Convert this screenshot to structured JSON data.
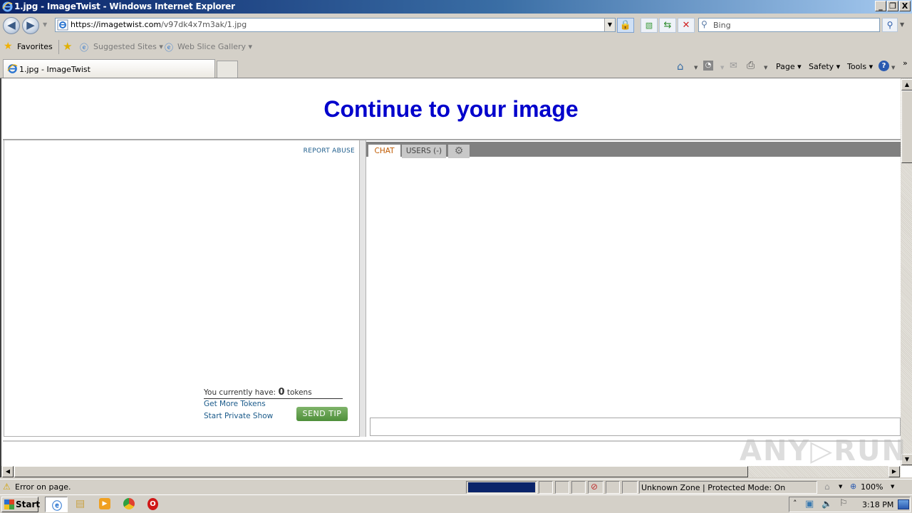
{
  "window": {
    "title": "1.jpg - ImageTwist - Windows Internet Explorer",
    "minimize": "_",
    "restore": "❐",
    "close": "X"
  },
  "address_bar": {
    "url_host": "https://imagetwist.com",
    "url_path": "/v97dk4x7m3ak/1.jpg",
    "search_placeholder": "Bing"
  },
  "favorites_bar": {
    "favorites_label": "Favorites",
    "items": [
      {
        "label": "Suggested Sites ▾"
      },
      {
        "label": "Web Slice Gallery ▾"
      }
    ]
  },
  "tabs": [
    {
      "label": "1.jpg - ImageTwist",
      "active": true
    }
  ],
  "command_bar": {
    "page": "Page ▾",
    "safety": "Safety ▾",
    "tools": "Tools ▾",
    "more": "»"
  },
  "page": {
    "heading": "Continue to your image",
    "left_panel": {
      "report_abuse": "REPORT ABUSE",
      "tokens_prefix": "You currently have:",
      "tokens_count": "0",
      "tokens_suffix": "tokens",
      "get_more_tokens": "Get More Tokens",
      "start_private_show": "Start Private Show",
      "send_tip": "SEND TIP"
    },
    "chat_panel": {
      "tabs": [
        {
          "label": "CHAT",
          "active": true
        },
        {
          "label": "USERS (-)",
          "active": false
        }
      ],
      "settings_icon": "gear-icon",
      "input_value": ""
    }
  },
  "status_bar": {
    "message": "Error on page.",
    "zone": "Unknown Zone | Protected Mode: On",
    "zoom": "100%"
  },
  "taskbar": {
    "start_label": "Start",
    "apps": [
      "internet-explorer",
      "file-explorer",
      "media-player",
      "chrome",
      "opera"
    ],
    "clock": "3:18 PM"
  },
  "watermark": "ANY▷RUN",
  "colors": {
    "heading": "#0000cc",
    "link": "#1a5a8a",
    "chat_active_tab": "#c05a00",
    "send_tip": "#5a9a45",
    "progress": "#0a246a"
  }
}
